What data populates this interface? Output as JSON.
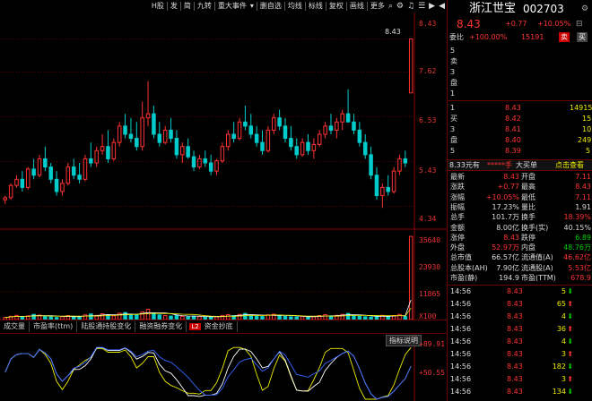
{
  "toolbar": {
    "items": [
      "H股",
      "发",
      "简",
      "九转",
      "重大事件",
      "▾",
      "删自选",
      "均线",
      "标线",
      "复权",
      "画线"
    ],
    "more": "更多",
    "icons": [
      "search-icon",
      "gear-icon",
      "bell-icon",
      "settings-icon",
      "forward-icon",
      "prev-icon"
    ]
  },
  "price_axis": {
    "labels": [
      "8.43",
      "7.62",
      "6.53",
      "5.43",
      "4.34"
    ],
    "top_marker": "8.43"
  },
  "volume_axis": {
    "labels": [
      "35640",
      "23930",
      "11865",
      "X100"
    ]
  },
  "macd_axis": {
    "labels": [
      "+89.91",
      "+50.55"
    ],
    "button": "指标说明"
  },
  "indicator_tabs": [
    "成交量",
    "市盈率(ttm)",
    "陆股通持股变化",
    "融资融券变化",
    "资金抄底"
  ],
  "indicator_badge": "L2",
  "stock": {
    "name": "浙江世宝",
    "code": "002703",
    "price": "8.43",
    "change": "+0.77",
    "pct": "+10.05%"
  },
  "weibi": {
    "label": "委比",
    "value": "+100.00%",
    "diff": "15191",
    "sell_btn": "卖",
    "buy_btn": "买"
  },
  "sell_levels": [
    {
      "label": "5",
      "price": "",
      "vol": ""
    },
    {
      "label": "卖",
      "price": "",
      "vol": ""
    },
    {
      "label": "3",
      "price": "",
      "vol": ""
    },
    {
      "label": "盘",
      "price": "",
      "vol": ""
    },
    {
      "label": "1",
      "price": "",
      "vol": ""
    }
  ],
  "buy_levels": [
    {
      "label": "1",
      "price": "8.43",
      "vol": "14915"
    },
    {
      "label": "买",
      "price": "8.42",
      "vol": "15"
    },
    {
      "label": "3",
      "price": "8.41",
      "vol": "10"
    },
    {
      "label": "盘",
      "price": "8.40",
      "vol": "249"
    },
    {
      "label": "5",
      "price": "8.39",
      "vol": "5"
    }
  ],
  "banner": {
    "left": "8.33元有",
    "mid": "*****手",
    "mid2": "大买单",
    "right": "点击查看"
  },
  "stats": [
    {
      "l": "最新",
      "v": "8.43",
      "l2": "开盘",
      "v2": "7.11"
    },
    {
      "l": "涨跌",
      "v": "+0.77",
      "l2": "最高",
      "v2": "8.43"
    },
    {
      "l": "涨幅",
      "v": "+10.05%",
      "l2": "最低",
      "v2": "7.11"
    },
    {
      "l": "振幅",
      "v": "17.23%",
      "l2": "量比",
      "v2": "1.91"
    },
    {
      "l": "总手",
      "v": "101.7万",
      "l2": "换手",
      "v2": "18.39%"
    },
    {
      "l": "金额",
      "v": "8.00亿",
      "l2": "换手(实)",
      "v2": "40.15%"
    },
    {
      "l": "涨停",
      "v": "8.43",
      "l2": "跌停",
      "v2": "6.89"
    },
    {
      "l": "外盘",
      "v": "52.97万",
      "l2": "内盘",
      "v2": "48.76万"
    },
    {
      "l": "总市值",
      "v": "66.57亿",
      "l2": "流通值(A)",
      "v2": "46.62亿"
    },
    {
      "l": "总股本(AH)",
      "v": "7.90亿",
      "l2": "流通股(A)",
      "v2": "5.53亿"
    },
    {
      "l": "市盈(静)",
      "v": "194.9",
      "l2": "市盈(TTM)",
      "v2": "678.9"
    }
  ],
  "ticks": [
    {
      "t": "14:56",
      "p": "8.43",
      "v": "5"
    },
    {
      "t": "14:56",
      "p": "8.43",
      "v": "65"
    },
    {
      "t": "14:56",
      "p": "8.43",
      "v": "4"
    },
    {
      "t": "14:56",
      "p": "8.43",
      "v": "36"
    },
    {
      "t": "14:56",
      "p": "8.43",
      "v": "4"
    },
    {
      "t": "14:56",
      "p": "8.43",
      "v": "3"
    },
    {
      "t": "14:56",
      "p": "8.43",
      "v": "182"
    },
    {
      "t": "14:56",
      "p": "8.43",
      "v": "3"
    },
    {
      "t": "14:56",
      "p": "8.43",
      "v": "134"
    }
  ],
  "colors": {
    "up": "#ff3333",
    "down": "#00cccc",
    "bg": "#000000",
    "grid": "#660000"
  },
  "chart_data": {
    "type": "candlestick",
    "ohlc": [
      [
        4.5,
        4.6,
        4.4,
        4.55
      ],
      [
        4.55,
        4.9,
        4.5,
        4.85
      ],
      [
        4.85,
        5.1,
        4.8,
        5.0
      ],
      [
        5.0,
        5.2,
        4.7,
        4.8
      ],
      [
        4.8,
        5.3,
        4.75,
        5.25
      ],
      [
        5.25,
        5.5,
        5.0,
        5.1
      ],
      [
        5.1,
        5.6,
        5.05,
        5.5
      ],
      [
        5.5,
        5.8,
        5.2,
        5.3
      ],
      [
        5.3,
        5.4,
        4.9,
        5.0
      ],
      [
        5.0,
        5.2,
        4.6,
        4.7
      ],
      [
        4.7,
        5.0,
        4.6,
        4.9
      ],
      [
        4.9,
        5.4,
        4.85,
        5.3
      ],
      [
        5.3,
        5.5,
        5.0,
        5.1
      ],
      [
        5.1,
        5.4,
        4.9,
        5.0
      ],
      [
        5.0,
        5.6,
        4.95,
        5.5
      ],
      [
        5.5,
        5.9,
        5.3,
        5.4
      ],
      [
        5.4,
        5.8,
        5.3,
        5.7
      ],
      [
        5.7,
        6.1,
        5.6,
        5.8
      ],
      [
        5.8,
        6.2,
        5.4,
        5.5
      ],
      [
        5.5,
        6.0,
        5.45,
        5.9
      ],
      [
        5.9,
        6.4,
        5.8,
        6.3
      ],
      [
        6.3,
        6.6,
        6.0,
        6.1
      ],
      [
        6.1,
        6.5,
        5.9,
        6.0
      ],
      [
        6.0,
        6.4,
        5.7,
        5.8
      ],
      [
        5.8,
        6.9,
        5.7,
        6.5
      ],
      [
        6.5,
        7.4,
        6.3,
        6.6
      ],
      [
        6.6,
        6.8,
        6.0,
        6.1
      ],
      [
        6.1,
        6.4,
        5.8,
        5.9
      ],
      [
        5.9,
        6.3,
        5.85,
        6.2
      ],
      [
        6.2,
        6.5,
        5.9,
        6.0
      ],
      [
        6.0,
        6.2,
        5.5,
        5.6
      ],
      [
        5.6,
        5.9,
        5.4,
        5.8
      ],
      [
        5.8,
        6.0,
        5.5,
        5.55
      ],
      [
        5.55,
        5.7,
        5.2,
        5.3
      ],
      [
        5.3,
        5.6,
        5.25,
        5.5
      ],
      [
        5.5,
        5.7,
        5.3,
        5.4
      ],
      [
        5.4,
        5.6,
        5.1,
        5.2
      ],
      [
        5.2,
        5.5,
        5.1,
        5.45
      ],
      [
        5.45,
        5.9,
        5.4,
        5.8
      ],
      [
        5.8,
        6.2,
        5.7,
        6.1
      ],
      [
        6.1,
        6.4,
        5.9,
        6.0
      ],
      [
        6.0,
        6.5,
        5.95,
        6.4
      ],
      [
        6.4,
        6.8,
        6.2,
        6.3
      ],
      [
        6.3,
        6.6,
        6.0,
        6.1
      ],
      [
        6.1,
        6.3,
        5.8,
        5.9
      ],
      [
        5.9,
        6.2,
        5.6,
        5.7
      ],
      [
        5.7,
        6.3,
        5.65,
        6.2
      ],
      [
        6.2,
        6.6,
        6.1,
        6.5
      ],
      [
        6.5,
        6.7,
        6.2,
        6.3
      ],
      [
        6.3,
        6.5,
        5.9,
        6.0
      ],
      [
        6.0,
        6.3,
        5.7,
        5.8
      ],
      [
        5.8,
        6.0,
        5.5,
        5.6
      ],
      [
        5.6,
        6.0,
        5.55,
        5.9
      ],
      [
        5.9,
        6.1,
        5.6,
        5.7
      ],
      [
        5.7,
        6.0,
        5.5,
        5.85
      ],
      [
        5.85,
        6.2,
        5.8,
        6.1
      ],
      [
        6.1,
        6.4,
        6.0,
        6.3
      ],
      [
        6.3,
        6.6,
        6.1,
        6.2
      ],
      [
        6.2,
        6.5,
        6.0,
        6.4
      ],
      [
        6.4,
        6.7,
        6.2,
        6.6
      ],
      [
        6.6,
        7.2,
        6.5,
        6.4
      ],
      [
        6.4,
        6.6,
        6.1,
        6.2
      ],
      [
        6.2,
        6.4,
        5.8,
        5.9
      ],
      [
        5.9,
        6.1,
        5.5,
        5.6
      ],
      [
        5.6,
        5.8,
        5.0,
        5.1
      ],
      [
        5.1,
        5.3,
        4.5,
        4.6
      ],
      [
        4.6,
        4.9,
        4.3,
        4.8
      ],
      [
        4.8,
        5.1,
        4.6,
        4.7
      ],
      [
        4.7,
        5.3,
        4.65,
        5.2
      ],
      [
        5.2,
        5.6,
        5.1,
        5.5
      ],
      [
        5.5,
        5.7,
        5.3,
        5.4
      ],
      [
        7.11,
        8.43,
        7.11,
        8.43
      ]
    ],
    "volume": [
      9,
      14,
      18,
      12,
      16,
      22,
      19,
      15,
      11,
      9,
      13,
      17,
      14,
      10,
      20,
      24,
      18,
      25,
      21,
      16,
      27,
      30,
      22,
      19,
      33,
      44,
      28,
      20,
      17,
      15,
      19,
      14,
      12,
      15,
      13,
      11,
      10,
      12,
      18,
      21,
      17,
      22,
      26,
      19,
      15,
      13,
      20,
      23,
      18,
      14,
      12,
      11,
      14,
      10,
      13,
      17,
      21,
      16,
      18,
      22,
      26,
      19,
      14,
      12,
      11,
      15,
      18,
      13,
      17,
      22,
      14,
      356
    ],
    "ylim": [
      4.0,
      8.9
    ],
    "volume_max": 35640
  }
}
